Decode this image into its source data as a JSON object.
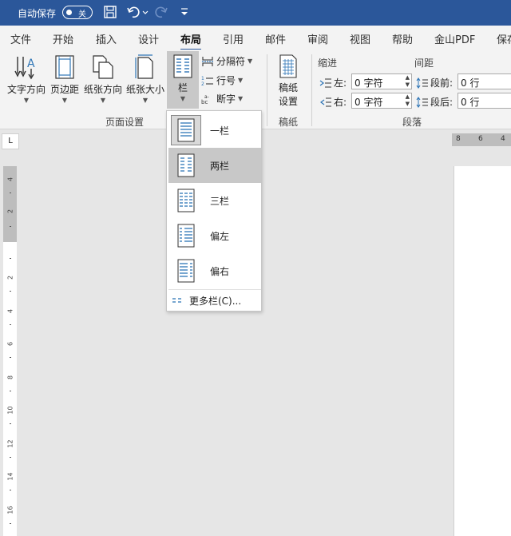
{
  "titlebar": {
    "autosave_label": "自动保存",
    "autosave_state": "关"
  },
  "tabs": [
    "文件",
    "开始",
    "插入",
    "设计",
    "布局",
    "引用",
    "邮件",
    "审阅",
    "视图",
    "帮助",
    "金山PDF",
    "保存"
  ],
  "active_tab": "布局",
  "ribbon": {
    "page_setup": {
      "text_direction": "文字方向",
      "margins": "页边距",
      "orientation": "纸张方向",
      "size": "纸张大小",
      "columns": "栏",
      "breaks": "分隔符",
      "line_numbers": "行号",
      "hyphenation": "断字",
      "group_label": "页面设置"
    },
    "manuscript": {
      "button_line1": "稿纸",
      "button_line2": "设置",
      "group_label": "稿纸"
    },
    "paragraph": {
      "indent_head": "缩进",
      "spacing_head": "间距",
      "left_label": "左:",
      "left_value": "0 字符",
      "right_label": "右:",
      "right_value": "0 字符",
      "before_label": "段前:",
      "before_value": "0 行",
      "after_label": "段后:",
      "after_value": "0 行",
      "group_label": "段落"
    }
  },
  "ruler": {
    "corner": "L",
    "horizontal_nums": [
      "8",
      "6",
      "4"
    ],
    "vertical_nums": [
      "4",
      "2",
      "",
      "2",
      "4",
      "6",
      "8",
      "10",
      "12",
      "14",
      "16"
    ]
  },
  "columns_menu": {
    "items": [
      "一栏",
      "两栏",
      "三栏",
      "偏左",
      "偏右"
    ],
    "selected_index": 1,
    "more_label": "更多栏(C)..."
  },
  "colors": {
    "titlebar": "#2b579a",
    "accent": "#2b579a",
    "icon_blue": "#2e75b6"
  }
}
